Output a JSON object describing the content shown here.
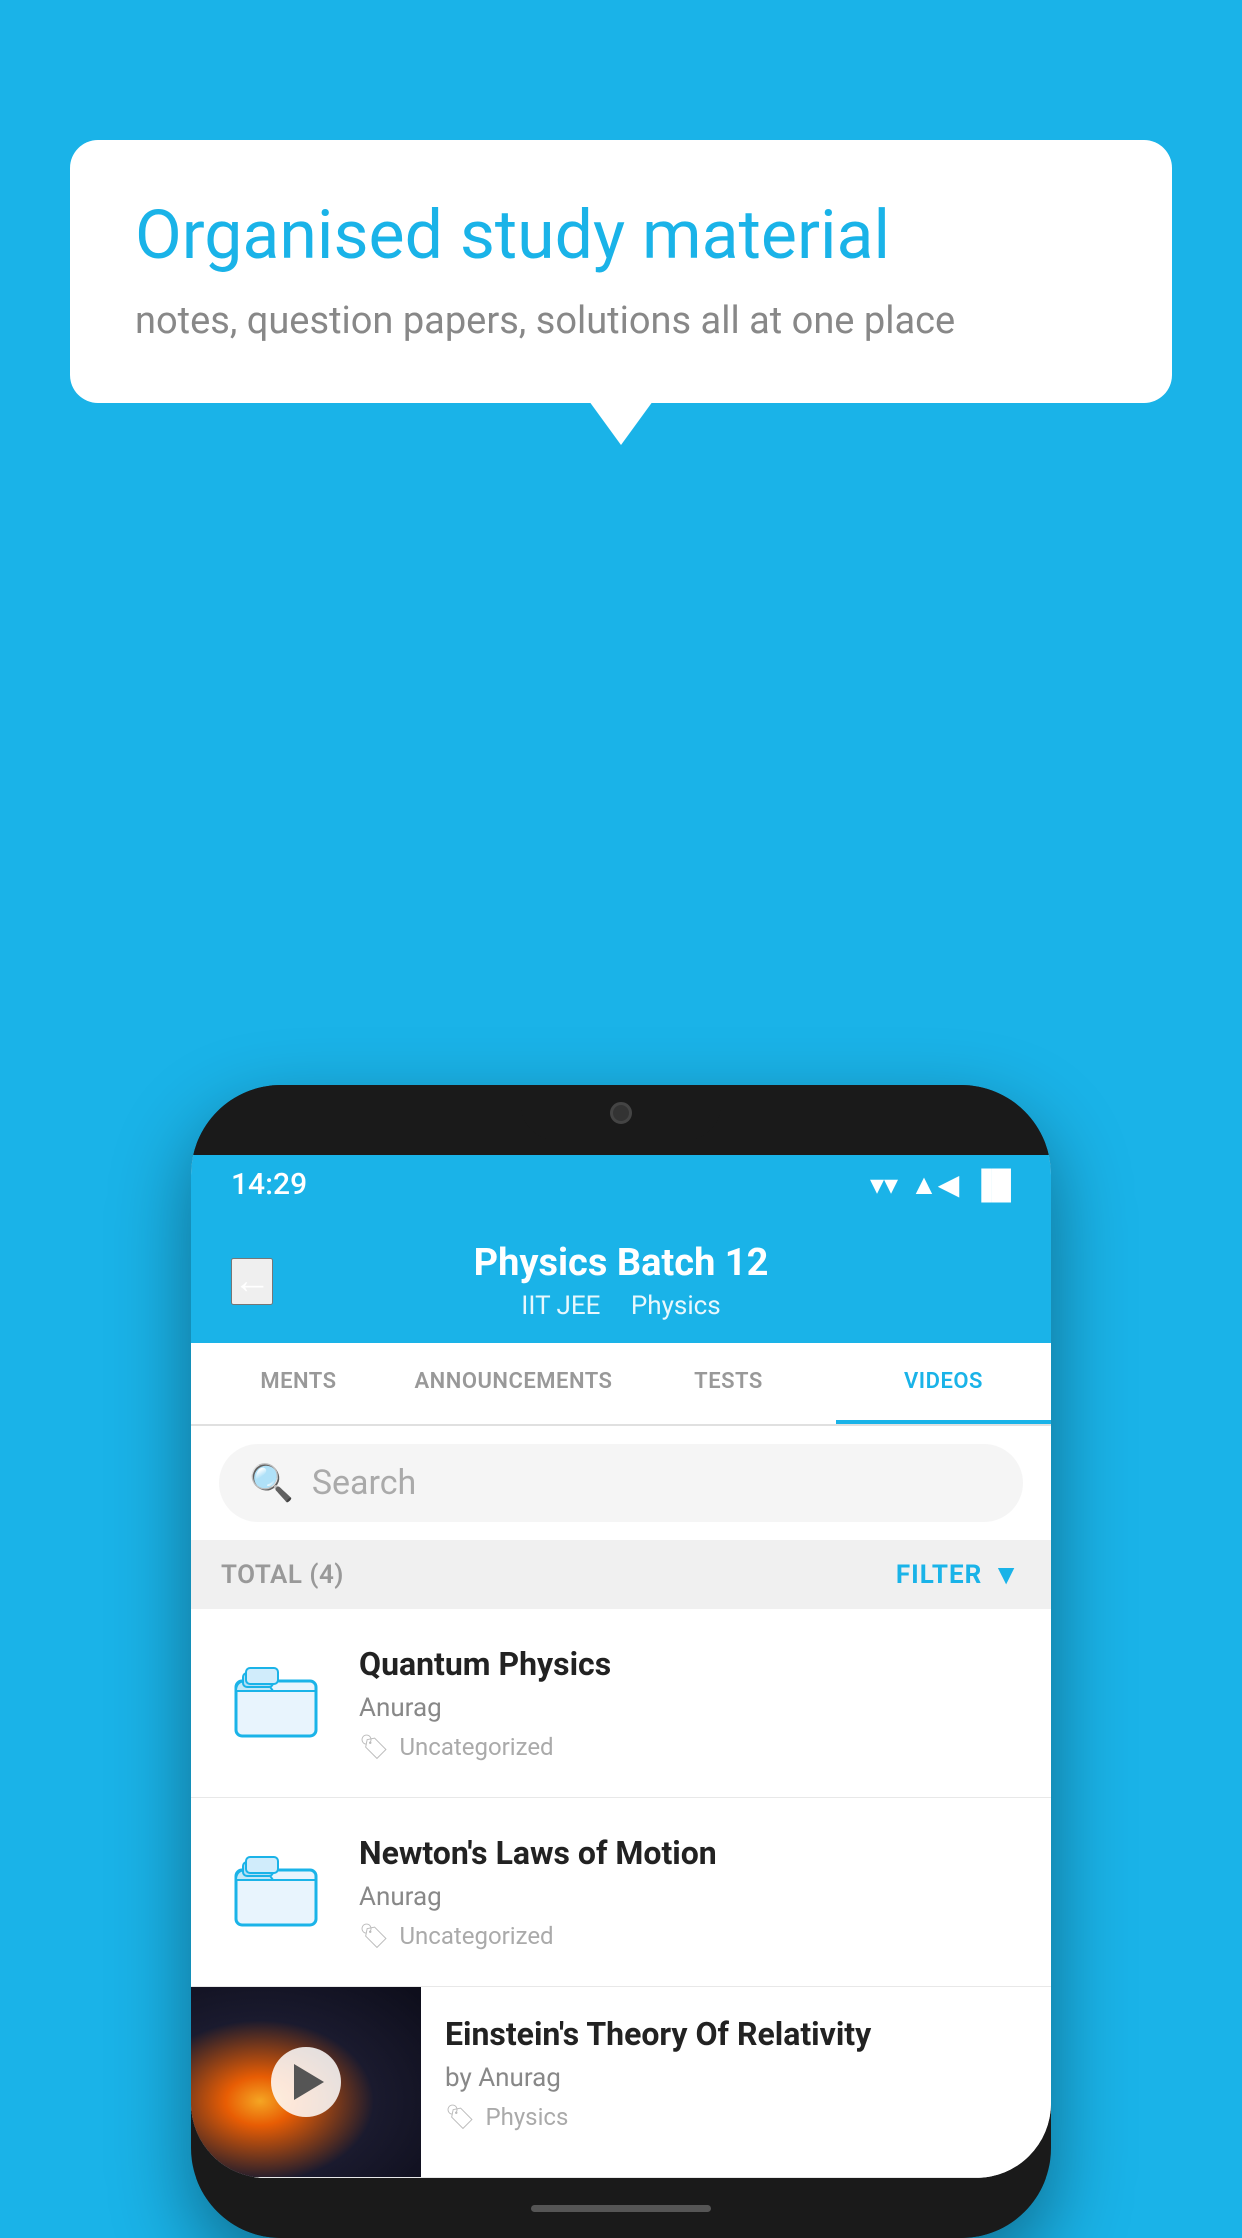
{
  "background": {
    "color": "#1ab3e8"
  },
  "speech_bubble": {
    "title": "Organised study material",
    "subtitle": "notes, question papers, solutions all at one place"
  },
  "status_bar": {
    "time": "14:29",
    "wifi": "▼",
    "signal": "◀",
    "battery": "▐"
  },
  "header": {
    "back_label": "←",
    "title": "Physics Batch 12",
    "subtitle_tag1": "IIT JEE",
    "subtitle_tag2": "Physics"
  },
  "tabs": [
    {
      "label": "MENTS",
      "active": false
    },
    {
      "label": "ANNOUNCEMENTS",
      "active": false
    },
    {
      "label": "TESTS",
      "active": false
    },
    {
      "label": "VIDEOS",
      "active": true
    }
  ],
  "search": {
    "placeholder": "Search"
  },
  "filter_bar": {
    "total_label": "TOTAL (4)",
    "filter_label": "FILTER"
  },
  "videos": [
    {
      "title": "Quantum Physics",
      "author": "Anurag",
      "tag": "Uncategorized",
      "type": "folder",
      "has_image": false
    },
    {
      "title": "Newton's Laws of Motion",
      "author": "Anurag",
      "tag": "Uncategorized",
      "type": "folder",
      "has_image": false
    },
    {
      "title": "Einstein's Theory Of Relativity",
      "author": "by Anurag",
      "tag": "Physics",
      "type": "video",
      "has_image": true
    }
  ]
}
